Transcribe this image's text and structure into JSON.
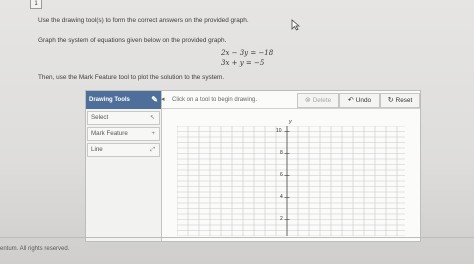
{
  "question": {
    "number": "1",
    "instruction": "Use the drawing tool(s) to form the correct answers on the provided graph.",
    "prompt": "Graph the system of equations given below on the provided graph.",
    "equations": [
      "2x − 3y  =  −18",
      "3x + y  =  −5"
    ],
    "followup": "Then, use the Mark Feature tool to plot the solution to the system."
  },
  "widget": {
    "sidebar_title": "Drawing Tools",
    "tools": [
      {
        "label": "Select",
        "icon": "↖"
      },
      {
        "label": "Mark Feature",
        "icon": "+"
      },
      {
        "label": "Line",
        "icon": "⤢"
      }
    ],
    "hint": "Click on a tool to begin drawing.",
    "delete_label": "Delete",
    "undo_label": "Undo",
    "reset_label": "Reset"
  },
  "graph": {
    "y_axis_label": "y",
    "y_ticks": [
      "10",
      "8",
      "6",
      "4",
      "2"
    ]
  },
  "footer": {
    "text": "entum. All rights reserved."
  }
}
